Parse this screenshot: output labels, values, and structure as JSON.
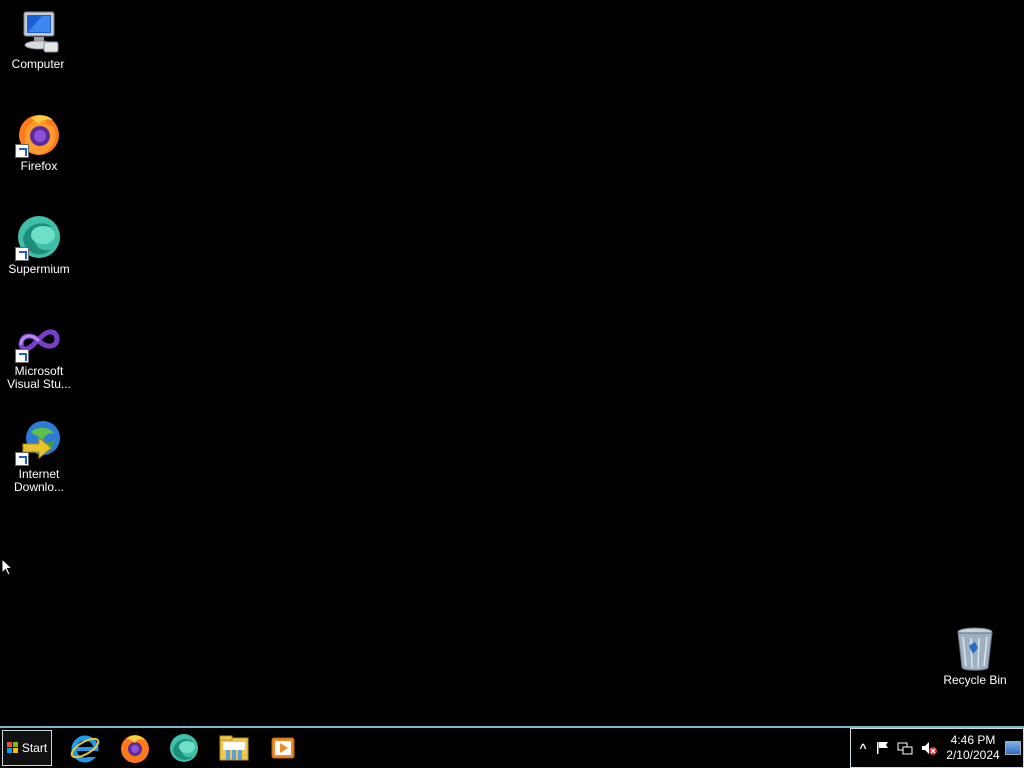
{
  "desktop": {
    "icons": [
      {
        "label": "Computer",
        "icon": "computer-icon"
      },
      {
        "label": "Firefox",
        "icon": "firefox-icon"
      },
      {
        "label": "Supermium",
        "icon": "supermium-icon"
      },
      {
        "label": "Microsoft Visual Stu...",
        "icon": "visual-studio-icon"
      },
      {
        "label": "Internet Downlo...",
        "icon": "internet-download-manager-icon"
      },
      {
        "label": "Recycle Bin",
        "icon": "recycle-bin-icon"
      }
    ]
  },
  "taskbar": {
    "start_label": "Start",
    "pinned": [
      {
        "name": "internet-explorer-icon"
      },
      {
        "name": "firefox-icon"
      },
      {
        "name": "supermium-icon"
      },
      {
        "name": "file-explorer-icon"
      },
      {
        "name": "media-player-icon"
      }
    ],
    "tray": {
      "expand_icon": "^",
      "time": "4:46 PM",
      "date": "2/10/2024"
    }
  },
  "colors": {
    "background": "#000000",
    "taskbar_border": "#7fb6c9"
  }
}
